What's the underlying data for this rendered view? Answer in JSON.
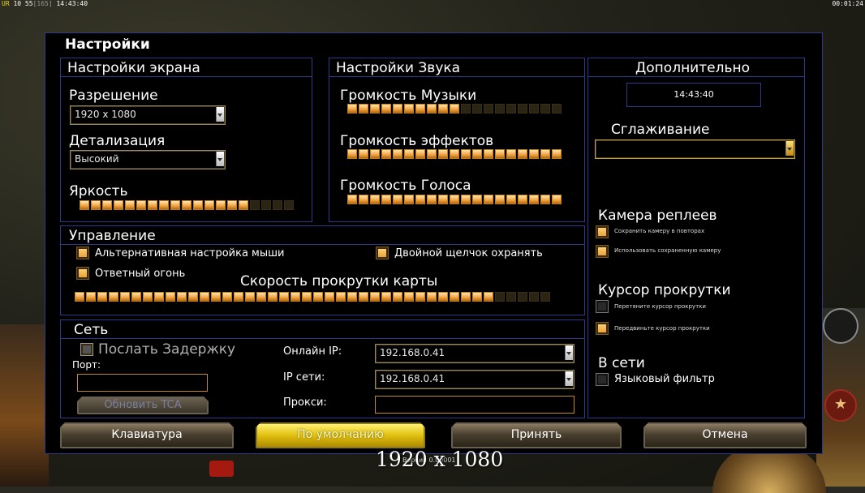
{
  "hud": {
    "left_ur": "UR",
    "left_nums": "10 55",
    "left_bracket": "[165]",
    "left_time": "14:43:40",
    "right_time": "00:01:24"
  },
  "dialog": {
    "title": "Настройки"
  },
  "screen": {
    "title": "Настройки экрана",
    "resolution_label": "Разрешение",
    "resolution_value": "1920 x 1080",
    "detail_label": "Детализация",
    "detail_value": "Высокий",
    "brightness_label": "Яркость",
    "brightness_level": 0.8
  },
  "sound": {
    "title": "Настройки Звука",
    "music_label": "Громкость Музыки",
    "music_level": 0.54,
    "effects_label": "Громкость эффектов",
    "effects_level": 1.0,
    "voice_label": "Громкость Голоса",
    "voice_level": 1.0
  },
  "extra": {
    "title": "Дополнительно",
    "clock": "14:43:40",
    "antialias_label": "Сглаживание",
    "antialias_value": "",
    "replay_camera_title": "Камера реплеев",
    "replay_save_camera": "Сохранить камеру в повторах",
    "replay_use_saved": "Использовать сохраненную камеру",
    "scroll_cursor_title": "Курсор прокрутки",
    "scroll_drag": "Перетяните курсор прокрутки",
    "scroll_move": "Передвиньте курсор прокрутки",
    "online_title": "В сети",
    "language_filter": "Языковый фильтр"
  },
  "control": {
    "title": "Управление",
    "alt_mouse": "Альтернативная настройка мыши",
    "double_click": "Двойной щелчок охранять",
    "return_fire": "Ответный огонь",
    "scroll_speed_label": "Скорость прокрутки карты",
    "scroll_speed_level": 0.88
  },
  "network": {
    "title": "Сеть",
    "send_delay": "Послать Задержку",
    "port_label": "Порт:",
    "update_tca": "Обновить TCA",
    "online_ip_label": "Онлайн IP:",
    "online_ip_value": "192.168.0.41",
    "lan_ip_label": "IP сети:",
    "lan_ip_value": "192.168.0.41",
    "proxy_label": "Прокси:"
  },
  "buttons": {
    "keyboard": "Клавиатура",
    "default": "По умолчанию",
    "accept": "Принять",
    "cancel": "Отмена"
  },
  "overlay": {
    "resolution": "1920 x 1080",
    "version": "Версия 0.00001"
  },
  "colors": {
    "panel_border": "#2d3a8a",
    "slider_on": "#f0a040",
    "accent_gold": "#d0a020"
  }
}
